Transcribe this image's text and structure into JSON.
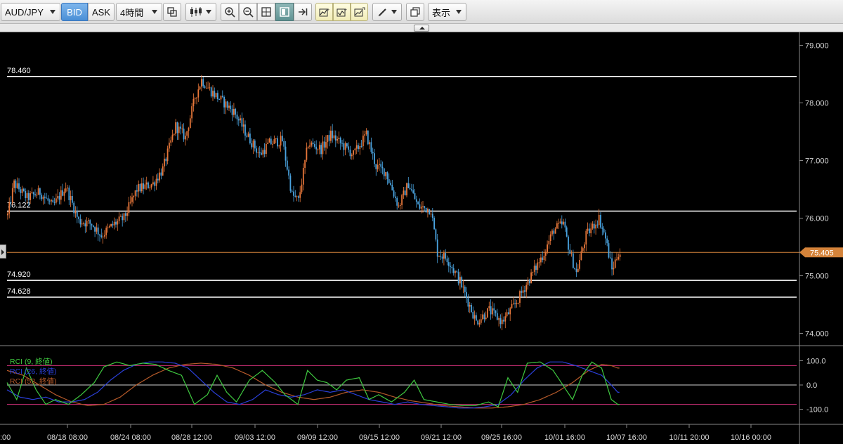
{
  "toolbar": {
    "symbol": "AUD/JPY",
    "bid_label": "BID",
    "ask_label": "ASK",
    "timeframe": "4時間",
    "display_label": "表示"
  },
  "icons": [
    "window-link-icon",
    "candlestick-type-icon",
    "zoom-in-icon",
    "zoom-out-icon",
    "fit-icon",
    "panel-toggle-icon",
    "scroll-end-icon",
    "add-indicator-icon",
    "add-subchart-icon",
    "indicator-settings-icon",
    "drawing-tool-icon",
    "window-copy-icon"
  ],
  "colors": {
    "background": "#000000",
    "up_candle": "#e8773a",
    "down_candle": "#4aa3df",
    "horizontal_line": "#ffffff",
    "price_line": "#d4833a",
    "rci_9": "#3fc940",
    "rci_26": "#2a3fd8",
    "rci_52": "#b65a2a",
    "rci_level": "#d0307a"
  },
  "price_panel": {
    "y_ticks": [
      "79.000",
      "78.000",
      "77.000",
      "76.000",
      "75.000",
      "74.000"
    ],
    "horizontal_lines": [
      {
        "label": "78.460",
        "value": 78.46
      },
      {
        "label": "76.122",
        "value": 76.122
      },
      {
        "label": "74.920",
        "value": 74.92
      },
      {
        "label": "74.628",
        "value": 74.628
      }
    ],
    "current_price": {
      "label": "75.405",
      "value": 75.405
    }
  },
  "rci_panel": {
    "legend": [
      "RCI (9, 終値)",
      "RCI (26, 終値)",
      "RCI (52, 終値)"
    ],
    "y_ticks": [
      "100.0",
      "0.0",
      "-100.0"
    ],
    "levels": [
      80,
      0,
      -80
    ]
  },
  "x_axis": {
    "ticks": [
      "08/18 08:00",
      "08/24 08:00",
      "08/28 12:00",
      "09/03 12:00",
      "09/09 12:00",
      "09/15 12:00",
      "09/21 12:00",
      "09/25 16:00",
      "10/01 16:00",
      "10/07 16:00",
      "10/11 20:00",
      "10/16 00:00"
    ],
    "left_partial": ":00"
  },
  "price_path": [
    {
      "i": 0,
      "v": 76.05
    },
    {
      "i": 4,
      "v": 76.6
    },
    {
      "i": 12,
      "v": 76.35
    },
    {
      "i": 20,
      "v": 76.45
    },
    {
      "i": 28,
      "v": 76.2
    },
    {
      "i": 36,
      "v": 76.55
    },
    {
      "i": 44,
      "v": 75.95
    },
    {
      "i": 52,
      "v": 75.9
    },
    {
      "i": 58,
      "v": 75.7
    },
    {
      "i": 66,
      "v": 75.9
    },
    {
      "i": 72,
      "v": 76.0
    },
    {
      "i": 80,
      "v": 76.5
    },
    {
      "i": 90,
      "v": 76.6
    },
    {
      "i": 96,
      "v": 76.85
    },
    {
      "i": 104,
      "v": 77.6
    },
    {
      "i": 110,
      "v": 77.4
    },
    {
      "i": 116,
      "v": 78.1
    },
    {
      "i": 120,
      "v": 78.4
    },
    {
      "i": 126,
      "v": 78.2
    },
    {
      "i": 134,
      "v": 78.0
    },
    {
      "i": 140,
      "v": 77.85
    },
    {
      "i": 148,
      "v": 77.45
    },
    {
      "i": 156,
      "v": 77.1
    },
    {
      "i": 162,
      "v": 77.3
    },
    {
      "i": 170,
      "v": 77.35
    },
    {
      "i": 176,
      "v": 76.4
    },
    {
      "i": 180,
      "v": 76.3
    },
    {
      "i": 186,
      "v": 77.3
    },
    {
      "i": 194,
      "v": 77.2
    },
    {
      "i": 200,
      "v": 77.45
    },
    {
      "i": 208,
      "v": 77.25
    },
    {
      "i": 214,
      "v": 77.1
    },
    {
      "i": 222,
      "v": 77.45
    },
    {
      "i": 228,
      "v": 76.9
    },
    {
      "i": 234,
      "v": 76.8
    },
    {
      "i": 242,
      "v": 76.2
    },
    {
      "i": 248,
      "v": 76.6
    },
    {
      "i": 254,
      "v": 76.2
    },
    {
      "i": 262,
      "v": 76.15
    },
    {
      "i": 266,
      "v": 75.4
    },
    {
      "i": 272,
      "v": 75.3
    },
    {
      "i": 280,
      "v": 74.9
    },
    {
      "i": 290,
      "v": 74.2
    },
    {
      "i": 298,
      "v": 74.4
    },
    {
      "i": 306,
      "v": 74.2
    },
    {
      "i": 314,
      "v": 74.5
    },
    {
      "i": 324,
      "v": 75.0
    },
    {
      "i": 332,
      "v": 75.4
    },
    {
      "i": 338,
      "v": 75.8
    },
    {
      "i": 344,
      "v": 75.9
    },
    {
      "i": 348,
      "v": 75.4
    },
    {
      "i": 352,
      "v": 75.05
    },
    {
      "i": 358,
      "v": 75.7
    },
    {
      "i": 366,
      "v": 76.0
    },
    {
      "i": 370,
      "v": 75.65
    },
    {
      "i": 374,
      "v": 75.1
    },
    {
      "i": 378,
      "v": 75.4
    }
  ],
  "rci9_path": [
    {
      "i": 0,
      "v": 10
    },
    {
      "i": 6,
      "v": -60
    },
    {
      "i": 12,
      "v": 70
    },
    {
      "i": 18,
      "v": -20
    },
    {
      "i": 24,
      "v": -80
    },
    {
      "i": 30,
      "v": -60
    },
    {
      "i": 38,
      "v": -80
    },
    {
      "i": 46,
      "v": -40
    },
    {
      "i": 54,
      "v": 10
    },
    {
      "i": 60,
      "v": 75
    },
    {
      "i": 68,
      "v": 95
    },
    {
      "i": 76,
      "v": 80
    },
    {
      "i": 84,
      "v": 90
    },
    {
      "i": 92,
      "v": 85
    },
    {
      "i": 100,
      "v": 60
    },
    {
      "i": 108,
      "v": 40
    },
    {
      "i": 116,
      "v": -80
    },
    {
      "i": 124,
      "v": -40
    },
    {
      "i": 130,
      "v": 40
    },
    {
      "i": 136,
      "v": -30
    },
    {
      "i": 142,
      "v": -70
    },
    {
      "i": 150,
      "v": 20
    },
    {
      "i": 158,
      "v": 60
    },
    {
      "i": 166,
      "v": 10
    },
    {
      "i": 172,
      "v": -40
    },
    {
      "i": 180,
      "v": -80
    },
    {
      "i": 186,
      "v": 60
    },
    {
      "i": 192,
      "v": 20
    },
    {
      "i": 198,
      "v": 10
    },
    {
      "i": 204,
      "v": -20
    },
    {
      "i": 210,
      "v": 20
    },
    {
      "i": 218,
      "v": 30
    },
    {
      "i": 224,
      "v": -60
    },
    {
      "i": 230,
      "v": -40
    },
    {
      "i": 238,
      "v": -70
    },
    {
      "i": 246,
      "v": -30
    },
    {
      "i": 252,
      "v": 20
    },
    {
      "i": 258,
      "v": -60
    },
    {
      "i": 266,
      "v": -70
    },
    {
      "i": 274,
      "v": -80
    },
    {
      "i": 282,
      "v": -85
    },
    {
      "i": 290,
      "v": -85
    },
    {
      "i": 298,
      "v": -70
    },
    {
      "i": 304,
      "v": -90
    },
    {
      "i": 310,
      "v": 30
    },
    {
      "i": 316,
      "v": -30
    },
    {
      "i": 322,
      "v": 90
    },
    {
      "i": 330,
      "v": 95
    },
    {
      "i": 338,
      "v": 60
    },
    {
      "i": 344,
      "v": 0
    },
    {
      "i": 350,
      "v": -60
    },
    {
      "i": 356,
      "v": 40
    },
    {
      "i": 362,
      "v": 95
    },
    {
      "i": 368,
      "v": 70
    },
    {
      "i": 374,
      "v": -60
    },
    {
      "i": 378,
      "v": -80
    }
  ],
  "rci26_path": [
    {
      "i": 0,
      "v": -20
    },
    {
      "i": 8,
      "v": -50
    },
    {
      "i": 16,
      "v": -60
    },
    {
      "i": 24,
      "v": -50
    },
    {
      "i": 32,
      "v": -70
    },
    {
      "i": 40,
      "v": -70
    },
    {
      "i": 48,
      "v": -60
    },
    {
      "i": 56,
      "v": -30
    },
    {
      "i": 64,
      "v": 20
    },
    {
      "i": 72,
      "v": 60
    },
    {
      "i": 80,
      "v": 85
    },
    {
      "i": 88,
      "v": 95
    },
    {
      "i": 96,
      "v": 95
    },
    {
      "i": 104,
      "v": 90
    },
    {
      "i": 112,
      "v": 70
    },
    {
      "i": 120,
      "v": 20
    },
    {
      "i": 128,
      "v": -30
    },
    {
      "i": 136,
      "v": -70
    },
    {
      "i": 144,
      "v": -80
    },
    {
      "i": 152,
      "v": -60
    },
    {
      "i": 160,
      "v": -20
    },
    {
      "i": 168,
      "v": -40
    },
    {
      "i": 176,
      "v": -50
    },
    {
      "i": 184,
      "v": -40
    },
    {
      "i": 192,
      "v": -20
    },
    {
      "i": 200,
      "v": -30
    },
    {
      "i": 208,
      "v": -20
    },
    {
      "i": 216,
      "v": -40
    },
    {
      "i": 224,
      "v": -60
    },
    {
      "i": 232,
      "v": -70
    },
    {
      "i": 240,
      "v": -80
    },
    {
      "i": 248,
      "v": -70
    },
    {
      "i": 256,
      "v": -80
    },
    {
      "i": 264,
      "v": -85
    },
    {
      "i": 272,
      "v": -90
    },
    {
      "i": 280,
      "v": -95
    },
    {
      "i": 288,
      "v": -95
    },
    {
      "i": 296,
      "v": -90
    },
    {
      "i": 304,
      "v": -80
    },
    {
      "i": 312,
      "v": -40
    },
    {
      "i": 320,
      "v": 20
    },
    {
      "i": 328,
      "v": 70
    },
    {
      "i": 336,
      "v": 95
    },
    {
      "i": 344,
      "v": 95
    },
    {
      "i": 352,
      "v": 80
    },
    {
      "i": 360,
      "v": 60
    },
    {
      "i": 368,
      "v": 40
    },
    {
      "i": 374,
      "v": 0
    },
    {
      "i": 378,
      "v": -30
    }
  ],
  "rci52_path": [
    {
      "i": 0,
      "v": 60
    },
    {
      "i": 10,
      "v": 40
    },
    {
      "i": 20,
      "v": 0
    },
    {
      "i": 30,
      "v": -40
    },
    {
      "i": 40,
      "v": -70
    },
    {
      "i": 50,
      "v": -85
    },
    {
      "i": 60,
      "v": -80
    },
    {
      "i": 70,
      "v": -50
    },
    {
      "i": 80,
      "v": 0
    },
    {
      "i": 90,
      "v": 40
    },
    {
      "i": 100,
      "v": 70
    },
    {
      "i": 110,
      "v": 85
    },
    {
      "i": 120,
      "v": 90
    },
    {
      "i": 130,
      "v": 85
    },
    {
      "i": 140,
      "v": 70
    },
    {
      "i": 150,
      "v": 40
    },
    {
      "i": 160,
      "v": 0
    },
    {
      "i": 170,
      "v": -30
    },
    {
      "i": 180,
      "v": -50
    },
    {
      "i": 190,
      "v": -60
    },
    {
      "i": 200,
      "v": -50
    },
    {
      "i": 210,
      "v": -30
    },
    {
      "i": 220,
      "v": -20
    },
    {
      "i": 230,
      "v": -30
    },
    {
      "i": 240,
      "v": -50
    },
    {
      "i": 250,
      "v": -65
    },
    {
      "i": 260,
      "v": -75
    },
    {
      "i": 270,
      "v": -85
    },
    {
      "i": 280,
      "v": -90
    },
    {
      "i": 290,
      "v": -95
    },
    {
      "i": 300,
      "v": -95
    },
    {
      "i": 310,
      "v": -90
    },
    {
      "i": 320,
      "v": -80
    },
    {
      "i": 330,
      "v": -60
    },
    {
      "i": 340,
      "v": -30
    },
    {
      "i": 350,
      "v": 10
    },
    {
      "i": 360,
      "v": 60
    },
    {
      "i": 368,
      "v": 85
    },
    {
      "i": 374,
      "v": 80
    },
    {
      "i": 378,
      "v": 70
    }
  ]
}
